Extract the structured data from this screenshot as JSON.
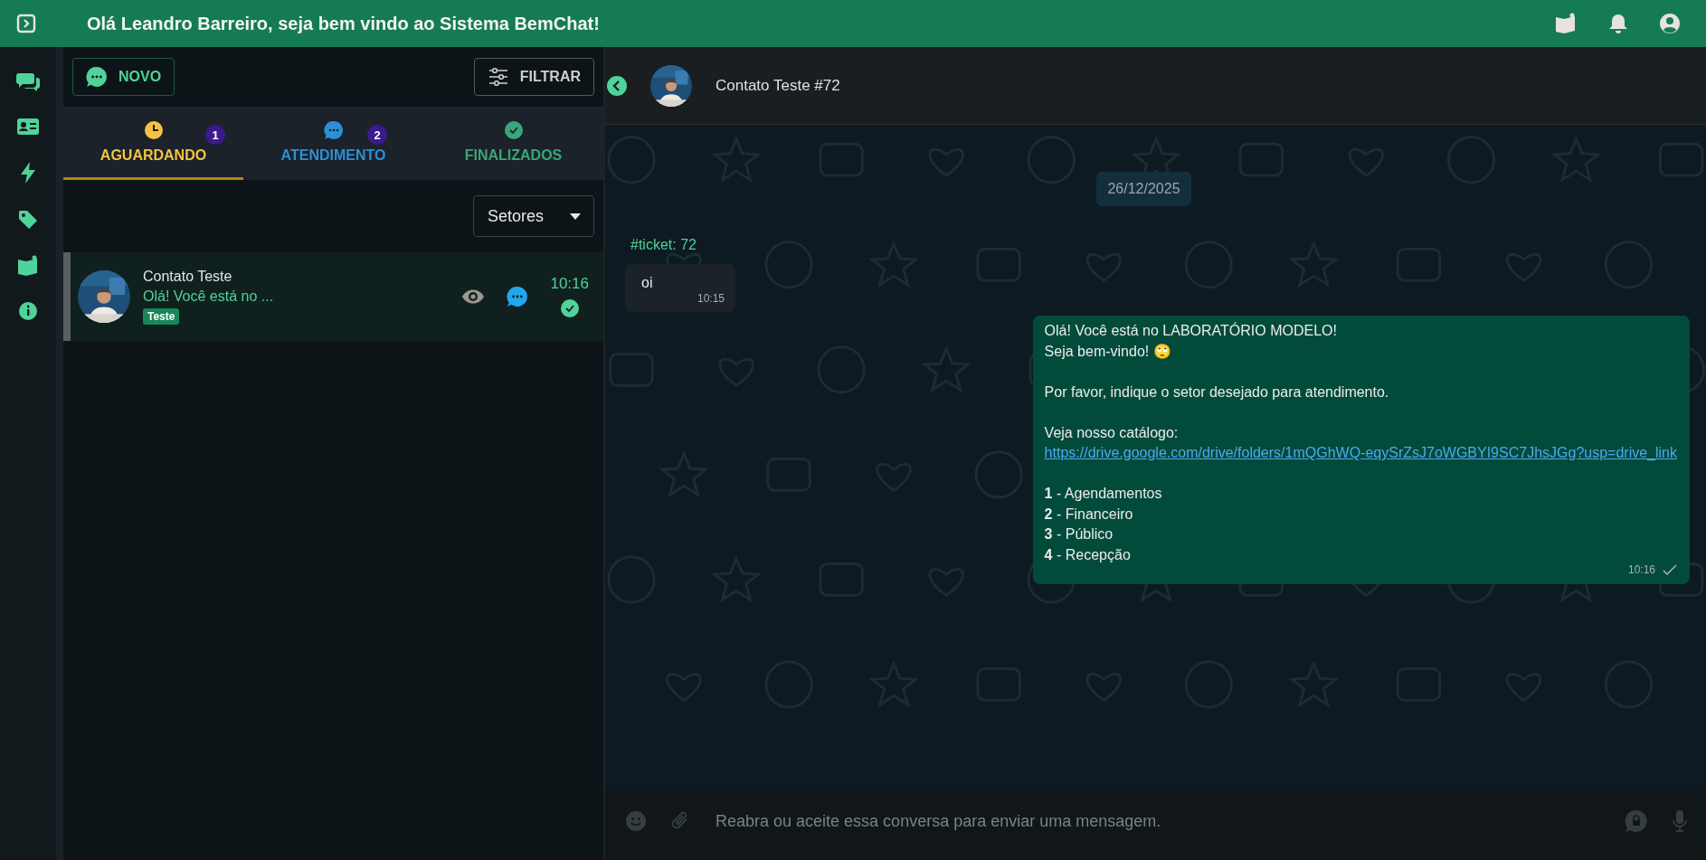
{
  "header": {
    "title": "Olá Leandro Barreiro, seja bem vindo ao Sistema BemChat!"
  },
  "tickets_panel": {
    "new_button": "NOVO",
    "filter_button": "FILTRAR",
    "tabs": [
      {
        "label": "AGUARDANDO",
        "count": "1",
        "selected": true,
        "kind": "waiting",
        "color": "#f5c242"
      },
      {
        "label": "ATENDIMENTO",
        "count": "2",
        "selected": false,
        "kind": "open",
        "color": "#2d8fd5"
      },
      {
        "label": "FINALIZADOS",
        "selected": false,
        "kind": "closed",
        "color": "#3aa57a"
      }
    ],
    "sector_select": "Setores",
    "tickets": [
      {
        "name": "Contato Teste",
        "preview": "Olá! Você está no ...",
        "tag": "Teste",
        "time": "10:16",
        "selected": true
      }
    ]
  },
  "chat": {
    "contact": "Contato Teste #72",
    "date": "26/12/2025",
    "ticket_label": "#ticket: 72",
    "messages": [
      {
        "from_me": false,
        "time": "10:15",
        "sent_tick": false,
        "paragraphs": [
          {
            "lines": [
              "oi"
            ]
          }
        ]
      },
      {
        "from_me": true,
        "time": "10:16",
        "sent_tick": true,
        "paragraphs": [
          {
            "lines": [
              "Olá! Você está no LABORATÓRIO MODELO!",
              "Seja bem-vindo! 🙄"
            ]
          },
          {
            "lines": [
              "Por favor, indique o setor desejado para atendimento."
            ]
          },
          {
            "lines": [
              "Veja nosso catálogo:"
            ],
            "link": "https://drive.google.com/drive/folders/1mQGhWQ-eqySrZsJ7oWGBYI9SC7JhsJGg?usp=drive_link"
          },
          {
            "lines": [
              "**1** - Agendamentos",
              "**2** - Financeiro",
              "**3** - Público",
              "**4** - Recepção"
            ]
          }
        ]
      }
    ],
    "input": {
      "placeholder": "Reabra ou aceite essa conversa para enviar uma mensagem.",
      "disabled": true
    }
  }
}
